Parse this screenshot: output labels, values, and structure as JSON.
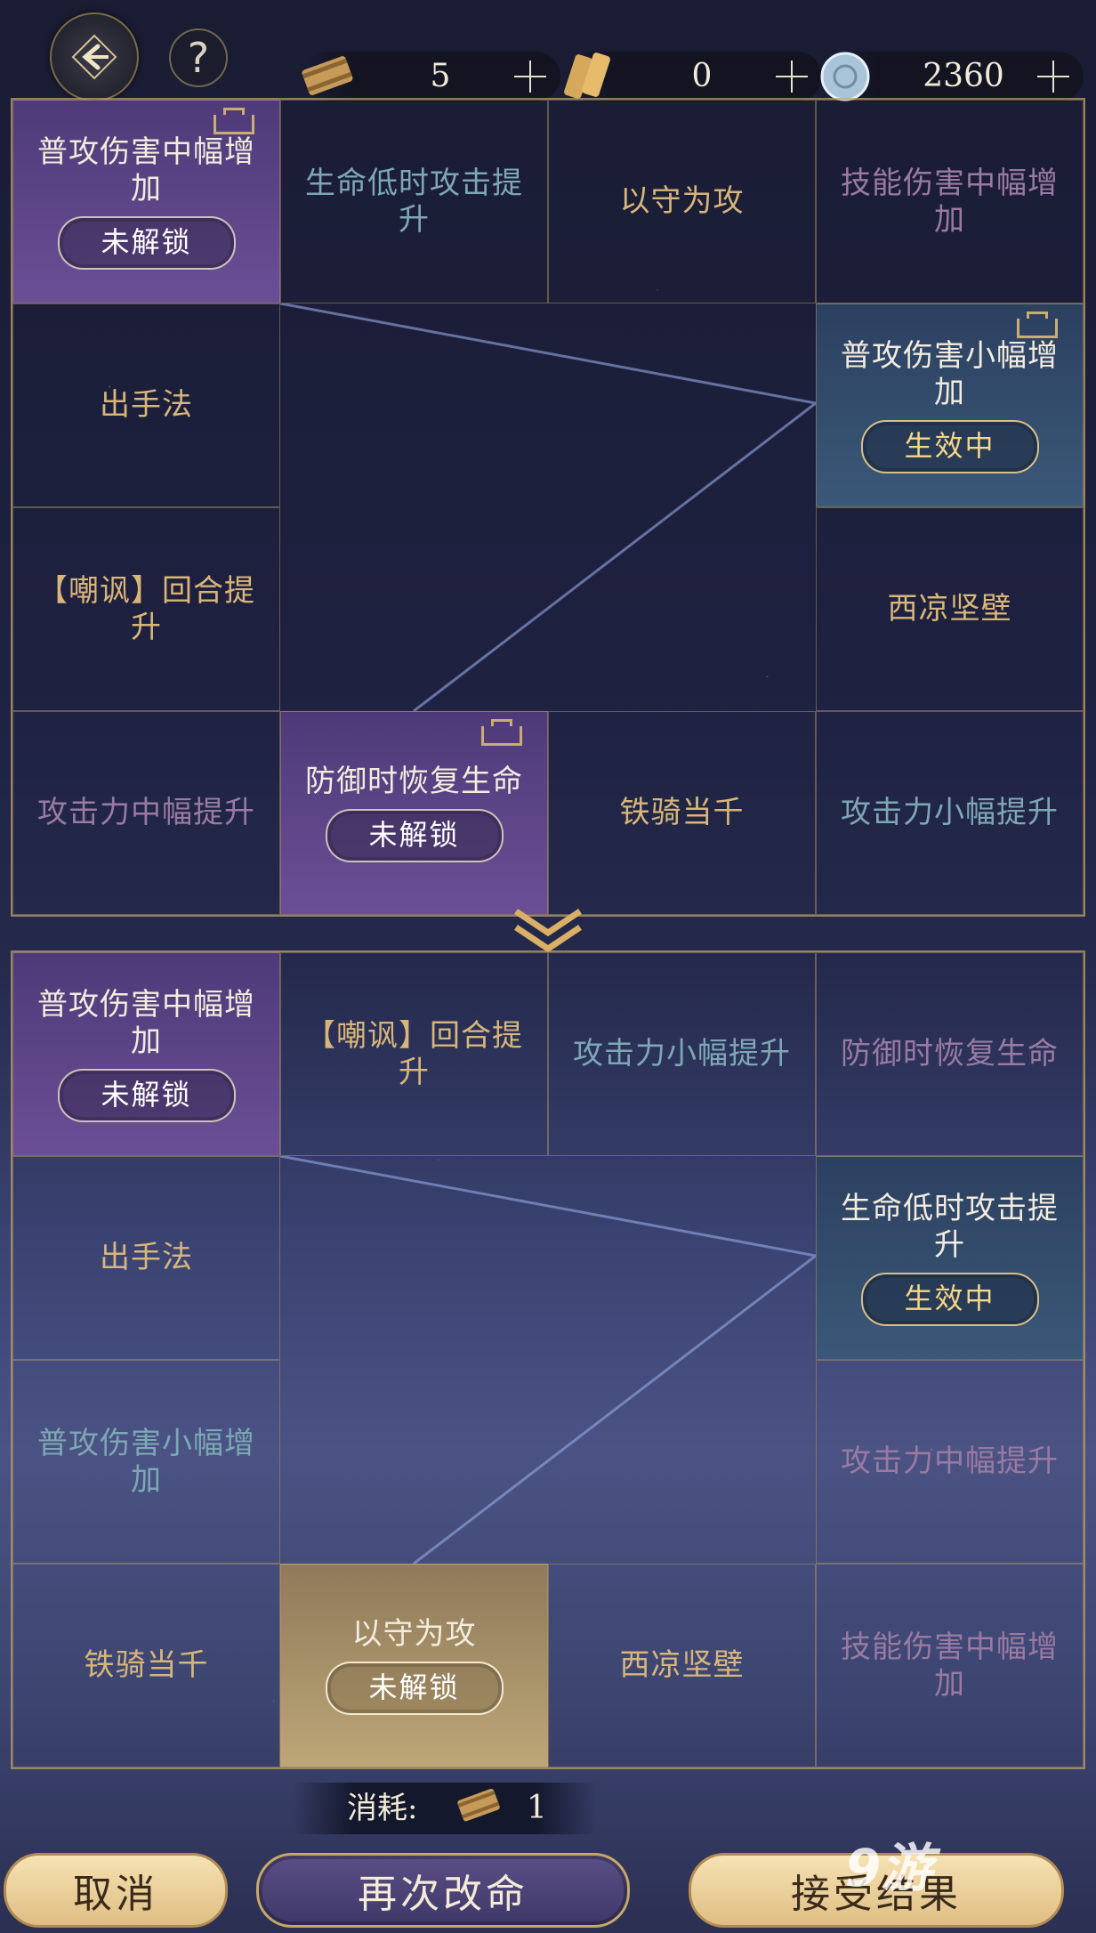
{
  "resources": [
    {
      "name": "scroll",
      "value": "5"
    },
    {
      "name": "token",
      "value": "0"
    },
    {
      "name": "jade",
      "value": "2360"
    }
  ],
  "help_label": "?",
  "grid_top": {
    "cells": [
      {
        "label": "普攻伤害中幅增加",
        "style": "purple",
        "color": "white",
        "badge": "未解锁",
        "lock": true
      },
      {
        "label": "生命低时攻击提升",
        "style": "plain",
        "color": "teal"
      },
      {
        "label": "以守为攻",
        "style": "plain",
        "color": "gold"
      },
      {
        "label": "技能伤害中幅增加",
        "style": "plain",
        "color": "pink"
      },
      {
        "label": "出手法",
        "style": "plain",
        "color": "gold"
      },
      {
        "label": "普攻伤害小幅增加",
        "style": "blue",
        "color": "white",
        "badge": "生效中",
        "lock": true
      },
      {
        "label": "【嘲讽】回合提升",
        "style": "plain",
        "color": "gold"
      },
      {
        "label": "西凉坚壁",
        "style": "plain",
        "color": "gold"
      },
      {
        "label": "攻击力中幅提升",
        "style": "plain",
        "color": "pink"
      },
      {
        "label": "防御时恢复生命",
        "style": "purple",
        "color": "white",
        "badge": "未解锁",
        "lock": true
      },
      {
        "label": "铁骑当千",
        "style": "plain",
        "color": "gold"
      },
      {
        "label": "攻击力小幅提升",
        "style": "plain",
        "color": "teal"
      }
    ]
  },
  "grid_bottom": {
    "cells": [
      {
        "label": "普攻伤害中幅增加",
        "style": "purple",
        "color": "white",
        "badge": "未解锁"
      },
      {
        "label": "【嘲讽】回合提升",
        "style": "plain",
        "color": "gold"
      },
      {
        "label": "攻击力小幅提升",
        "style": "plain",
        "color": "teal"
      },
      {
        "label": "防御时恢复生命",
        "style": "plain",
        "color": "pink"
      },
      {
        "label": "出手法",
        "style": "plain",
        "color": "gold"
      },
      {
        "label": "生命低时攻击提升",
        "style": "blue",
        "color": "white",
        "badge": "生效中"
      },
      {
        "label": "普攻伤害小幅增加",
        "style": "plain",
        "color": "teal"
      },
      {
        "label": "攻击力中幅提升",
        "style": "plain",
        "color": "pink"
      },
      {
        "label": "铁骑当千",
        "style": "plain",
        "color": "gold"
      },
      {
        "label": "以守为攻",
        "style": "tan",
        "color": "white",
        "badge": "未解锁"
      },
      {
        "label": "西凉坚壁",
        "style": "plain",
        "color": "gold"
      },
      {
        "label": "技能伤害中幅增加",
        "style": "plain",
        "color": "pink"
      }
    ]
  },
  "cost": {
    "label": "消耗:",
    "value": "1"
  },
  "buttons": {
    "cancel": "取消",
    "reroll": "再次改命",
    "accept": "接受结果"
  },
  "watermark": "9游"
}
